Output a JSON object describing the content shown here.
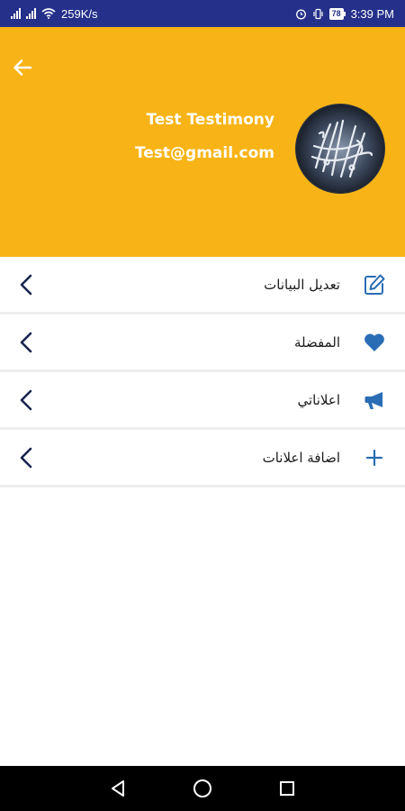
{
  "status_bar": {
    "network_speed": "259K/s",
    "battery_level": "78",
    "time": "3:39 PM"
  },
  "header": {
    "user_name": "Test Testimony",
    "user_email": "Test@gmail.com",
    "background_color": "#f8b416"
  },
  "menu": {
    "items": [
      {
        "label": "تعديل البيانات",
        "icon": "edit-icon"
      },
      {
        "label": "المفضلة",
        "icon": "heart-icon"
      },
      {
        "label": "اعلاناتي",
        "icon": "megaphone-icon"
      },
      {
        "label": "اضافة اعلانات",
        "icon": "plus-icon"
      }
    ],
    "icon_color": "#2a6db5",
    "chevron_color": "#1a2550"
  }
}
